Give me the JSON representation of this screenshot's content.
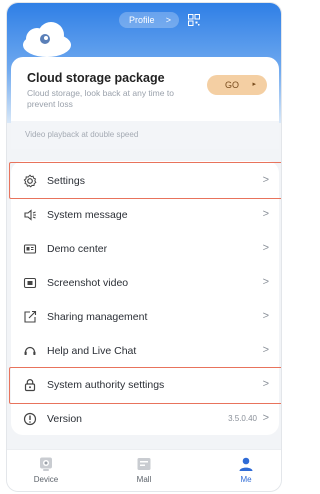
{
  "header": {
    "profile_label": "Profile",
    "profile_chevron": ">"
  },
  "cloud_card": {
    "title": "Cloud storage package",
    "subtitle": "Cloud storage, look back at any time to prevent loss",
    "go_label": "GO",
    "go_arrow": "▸"
  },
  "promo": {
    "text": "Video playback at double speed"
  },
  "menu": {
    "items": [
      {
        "label": "Settings",
        "icon": "gear-icon"
      },
      {
        "label": "System message",
        "icon": "message-icon"
      },
      {
        "label": "Demo center",
        "icon": "demo-icon"
      },
      {
        "label": "Screenshot video",
        "icon": "screenshot-icon"
      },
      {
        "label": "Sharing management",
        "icon": "share-icon"
      },
      {
        "label": "Help and Live Chat",
        "icon": "headset-icon"
      },
      {
        "label": "System authority settings",
        "icon": "lock-icon"
      },
      {
        "label": "Version",
        "icon": "info-icon",
        "value": "3.5.0.40"
      }
    ],
    "chevron": ">"
  },
  "tabbar": {
    "tabs": [
      {
        "label": "Device",
        "icon": "camera-icon"
      },
      {
        "label": "Mall",
        "icon": "store-icon"
      },
      {
        "label": "Me",
        "icon": "person-icon",
        "active": true
      }
    ]
  },
  "colors": {
    "accent": "#2f6bd6",
    "highlight": "#e8735c",
    "go_button": "#f4cfa3"
  }
}
